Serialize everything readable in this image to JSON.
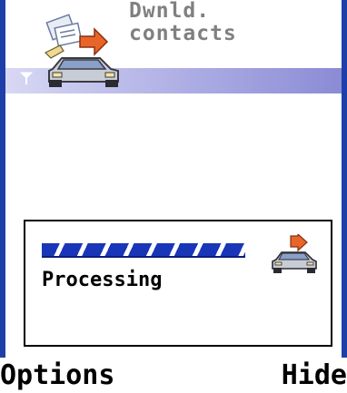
{
  "title": {
    "line1": "Dwnld.",
    "line2": "contacts",
    "icon": "download-contacts-icon"
  },
  "status": {
    "signal_icon": "signal-antenna-icon"
  },
  "dialog": {
    "text": "Processing",
    "progress": 0.95,
    "icon": "car-download-icon"
  },
  "softkeys": {
    "left": "Options",
    "right": "Hide"
  },
  "colors": {
    "frame": "#1f3fa8",
    "progress": "#1a36b8",
    "title_text": "#808080"
  }
}
